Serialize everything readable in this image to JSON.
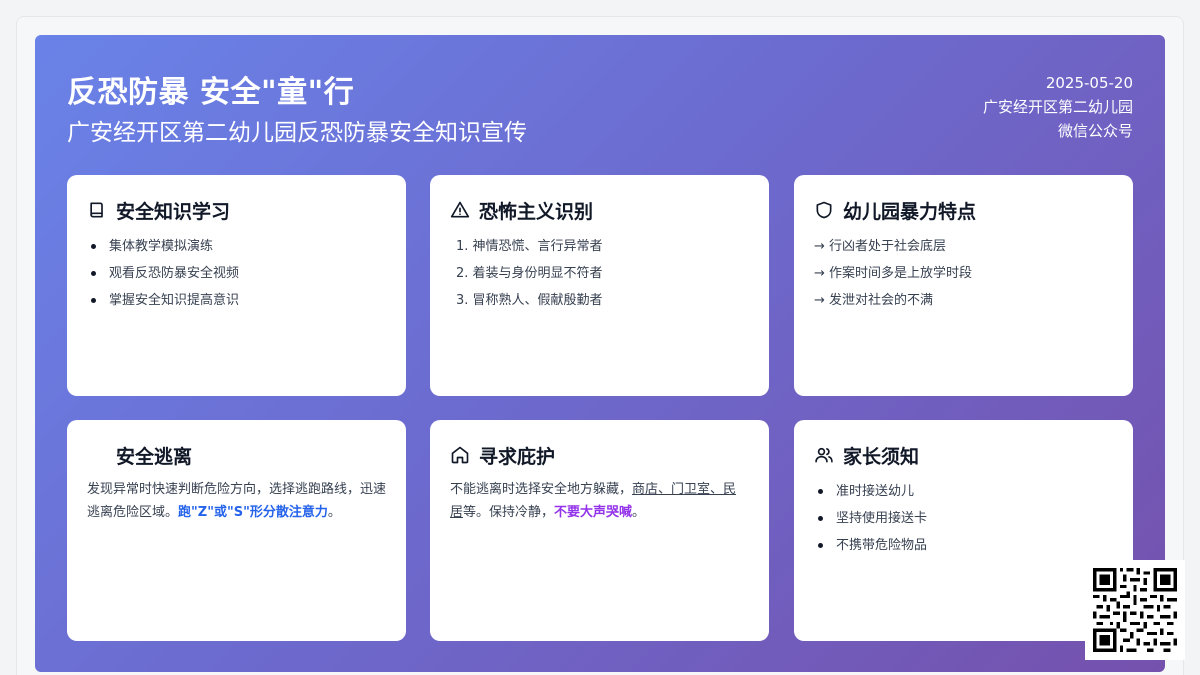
{
  "header": {
    "title": "反恐防暴 安全\"童\"行",
    "subtitle": "广安经开区第二幼儿园反恐防暴安全知识宣传",
    "date": "2025-05-20",
    "org": "广安经开区第二幼儿园",
    "channel": "微信公众号"
  },
  "cards": {
    "learning": {
      "icon": "book-icon",
      "title": "安全知识学习",
      "items": [
        "集体教学模拟演练",
        "观看反恐防暴安全视频",
        "掌握安全知识提高意识"
      ]
    },
    "identify": {
      "icon": "warning-triangle-icon",
      "title": "恐怖主义识别",
      "items": [
        "1. 神情恐慌、言行异常者",
        "2. 着装与身份明显不符者",
        "3. 冒称熟人、假献殷勤者"
      ]
    },
    "violence": {
      "icon": "shield-icon",
      "title": "幼儿园暴力特点",
      "items": [
        "→ 行凶者处于社会底层",
        "→ 作案时间多是上放学时段",
        "→ 发泄对社会的不满"
      ]
    },
    "escape": {
      "title": "安全逃离",
      "text_before": "发现异常时快速判断危险方向，选择逃跑路线，迅速逃离危险区域。",
      "highlight": "跑\"Z\"或\"S\"形分散注意力",
      "text_after": "。"
    },
    "shelter": {
      "icon": "home-icon",
      "title": "寻求庇护",
      "text_before": "不能逃离时选择安全地方躲藏，",
      "link": "商店、门卫室、民居",
      "text_middle": "等。保持冷静，",
      "highlight": "不要大声哭喊",
      "text_after": "。"
    },
    "parents": {
      "icon": "users-icon",
      "title": "家长须知",
      "items": [
        "准时接送幼儿",
        "坚持使用接送卡",
        "不携带危险物品"
      ]
    }
  },
  "colors": {
    "gradient_start": "#6a83e8",
    "gradient_end": "#7551ad",
    "highlight_blue": "#2563eb",
    "highlight_purple": "#9333ea"
  },
  "qr": {
    "icon": "qr-code-icon"
  }
}
